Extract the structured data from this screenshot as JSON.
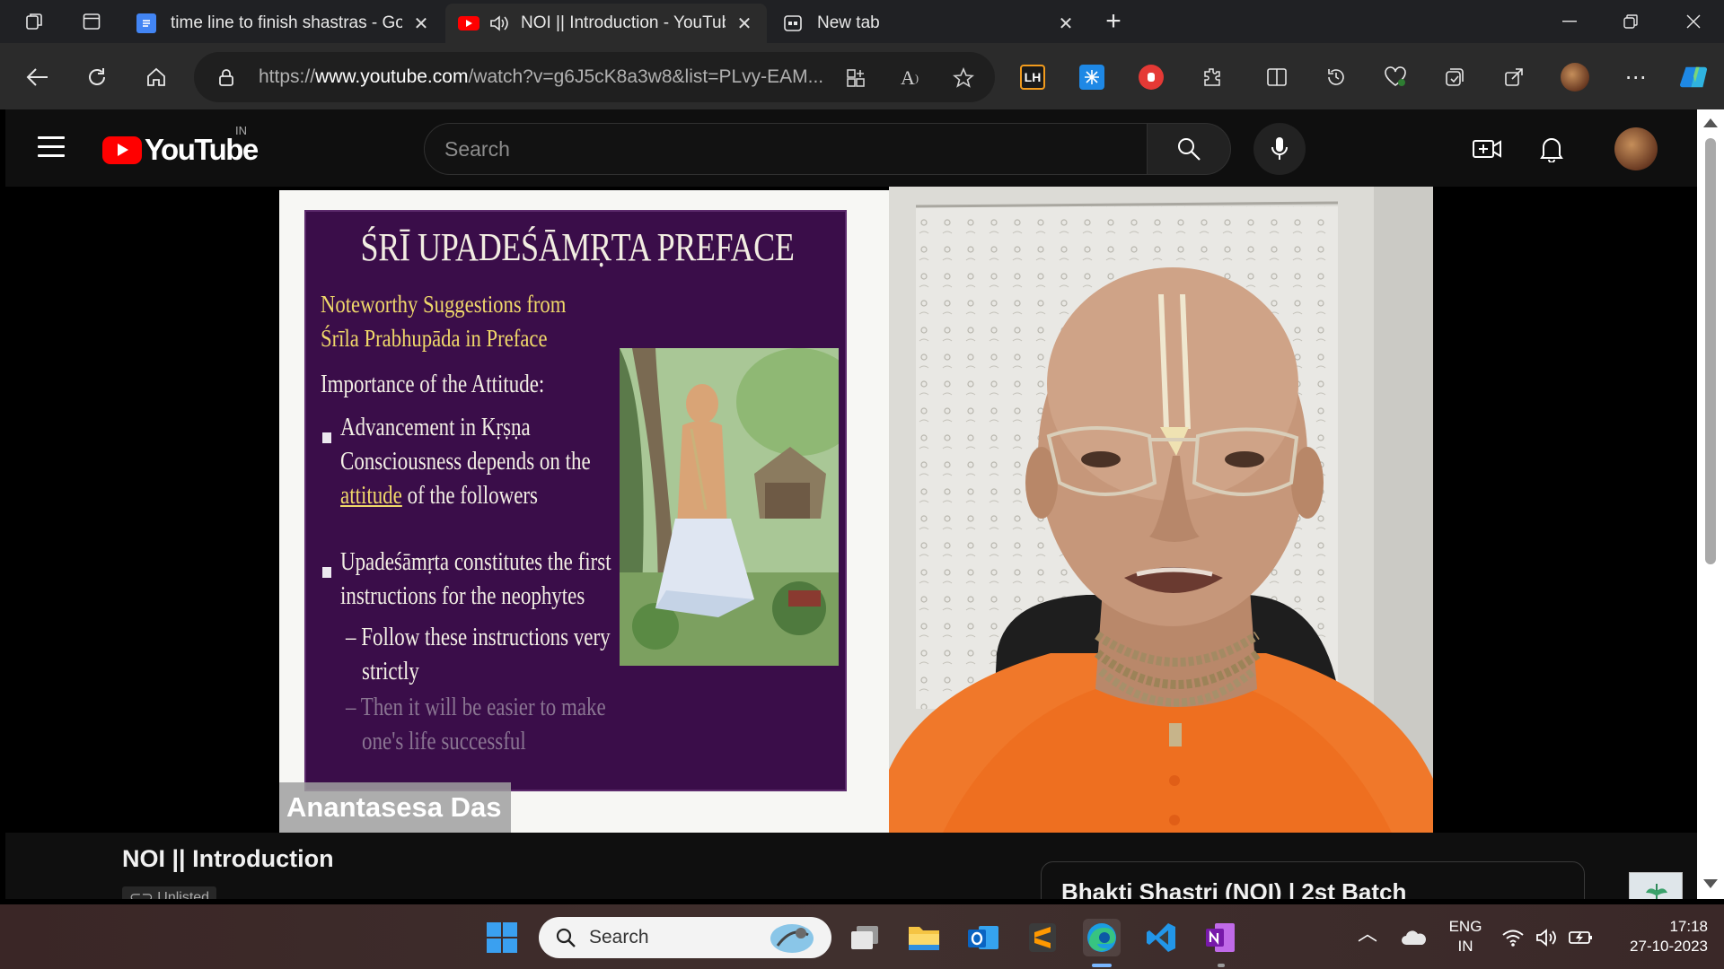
{
  "browser": {
    "tabs": [
      {
        "title": "time line to finish shastras - Goo",
        "active": false
      },
      {
        "title": "NOI || Introduction - YouTub",
        "active": true
      },
      {
        "title": "New tab",
        "active": false
      }
    ],
    "url": {
      "scheme": "https://",
      "host": "www.youtube.com",
      "path": "/watch?v=g6J5cK8a3w8&list=PLvy-EAM..."
    },
    "extensions": [
      "LH"
    ]
  },
  "youtube": {
    "logo_text": "YouTube",
    "country_code": "IN",
    "search_placeholder": "Search",
    "video_title": "NOI || Introduction",
    "visibility": "Unlisted",
    "playlist_title": "Bhakti Shastri (NOI) | 2st Batch"
  },
  "slide": {
    "title": "ŚRĪ UPADEŚĀMṚTA PREFACE",
    "subtitle_lines": [
      "Noteworthy Suggestions from",
      "Śrīla Prabhupāda in Preface"
    ],
    "heading": "Importance of the Attitude:",
    "bullet1_lines": [
      "Advancement in Kṛṣṇa",
      "Consciousness depends on the"
    ],
    "bullet1_emph": "attitude",
    "bullet1_rest": " of the followers",
    "bullet2_lines": [
      "Upadeśāmṛta constitutes the first",
      "instructions for the neophytes"
    ],
    "sub1_lines": [
      "– Follow these instructions very",
      "strictly"
    ],
    "sub2_lines": [
      "– Then it will be easier to make",
      "one's life successful"
    ]
  },
  "speaker_name": "Anantasesa Das",
  "taskbar": {
    "search_placeholder": "Search",
    "language": "ENG",
    "region": "IN",
    "time": "17:18",
    "date": "27-10-2023"
  },
  "colors": {
    "youtube_red": "#ff0000",
    "slide_bg": "#3a0d49",
    "slide_accent": "#f0d86a"
  }
}
